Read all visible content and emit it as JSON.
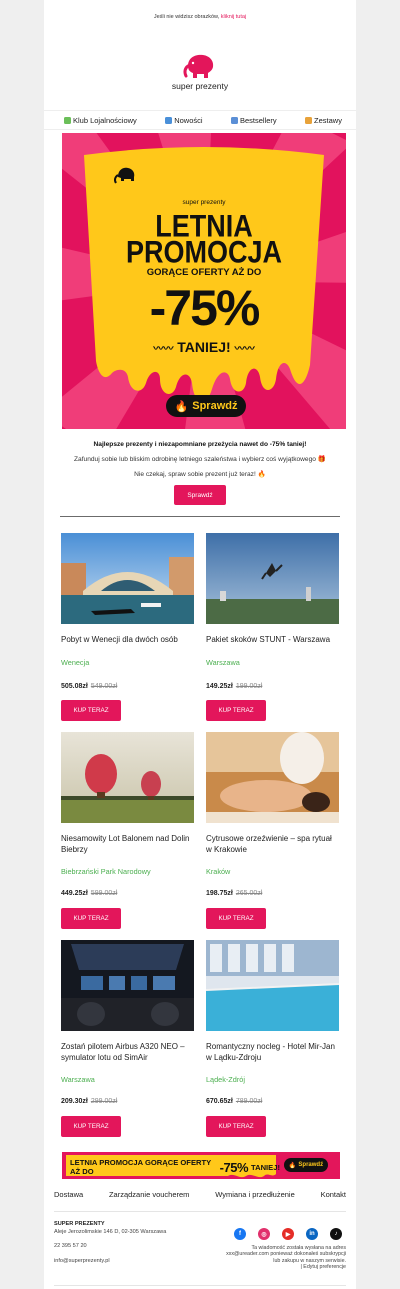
{
  "preheader": {
    "text": "Jeśli nie widzisz obrazków,",
    "link": "kliknij tutaj"
  },
  "brand": {
    "name": "super prezenty",
    "accent": "#e3165b",
    "green": "#4caf50"
  },
  "nav": {
    "loyalty": "Klub Lojalnościowy",
    "new": "Nowości",
    "bestsellers": "Bestsellery",
    "sets": "Zestawy"
  },
  "banner": {
    "brand": "super prezenty",
    "line1": "LETNIA",
    "line2": "PROMOCJA",
    "line3": "GORĄCE OFERTY AŻ DO",
    "discount": "-75%",
    "tagline": "TANIEJ!",
    "button": "Sprawdź"
  },
  "intro": {
    "headline": "Najlepsze prezenty i niezapomniane przeżycia nawet do -75% taniej!",
    "line2": "Zafunduj sobie lub bliskim odrobinę letniego szaleństwa i wybierz coś wyjątkowego 🎁",
    "line3": "Nie czekaj, spraw sobie prezent już teraz! 🔥",
    "button": "Sprawdź"
  },
  "products": [
    {
      "title": "Pobyt w Wenecji dla dwóch osób",
      "city": "Wenecja",
      "price": "505.08zł",
      "old_price": "549.00zł",
      "button": "KUP TERAZ",
      "image": "venice-photo"
    },
    {
      "title": "Pakiet skoków STUNT - Warszawa",
      "city": "Warszawa",
      "price": "149.25zł",
      "old_price": "199.00zł",
      "button": "KUP TERAZ",
      "image": "stunt-jump-photo"
    },
    {
      "title": "Niesamowity Lot Balonem nad Dolin Biebrzy",
      "city": "Biebrzański Park Narodowy",
      "price": "449.25zł",
      "old_price": "599.00zł",
      "button": "KUP TERAZ",
      "image": "balloon-photo"
    },
    {
      "title": "Cytrusowe orzeźwienie – spa rytuał w Krakowie",
      "city": "Kraków",
      "price": "198.75zł",
      "old_price": "265.00zł",
      "button": "KUP TERAZ",
      "image": "spa-photo"
    },
    {
      "title": "Zostań pilotem Airbus A320 NEO – symulator lotu od SimAir",
      "city": "Warszawa",
      "price": "209.30zł",
      "old_price": "299.00zł",
      "button": "KUP TERAZ",
      "image": "cockpit-photo"
    },
    {
      "title": "Romantyczny nocleg - Hotel Mir-Jan w Lądku-Zdroju",
      "city": "Lądek-Zdrój",
      "price": "670.65zł",
      "old_price": "789.00zł",
      "button": "KUP TERAZ",
      "image": "pool-photo"
    }
  ],
  "strip": {
    "text": "LETNIA PROMOCJA GORĄCE OFERTY AŻ DO",
    "discount": "-75%",
    "tagline": "TANIEJ!",
    "button": "Sprawdź"
  },
  "footer": {
    "links": [
      "Dostawa",
      "Zarządzanie voucherem",
      "Wymiana i przedłużenie",
      "Kontakt"
    ],
    "company": "SUPER PREZENTY",
    "address": "Aleje Jerozolimskie 146 D, 02-305 Warszawa",
    "phone": "22 395 57 20",
    "email": "info@superprezenty.pl",
    "legal1": "Ta wiadomość została wysłana na adres",
    "legal2": "xxx@ureader.com ponieważ dokonałeś subskrypcji",
    "legal3": "lub zakupu w naszym serwisie.",
    "legal4": "| Edytuj preferencje"
  }
}
